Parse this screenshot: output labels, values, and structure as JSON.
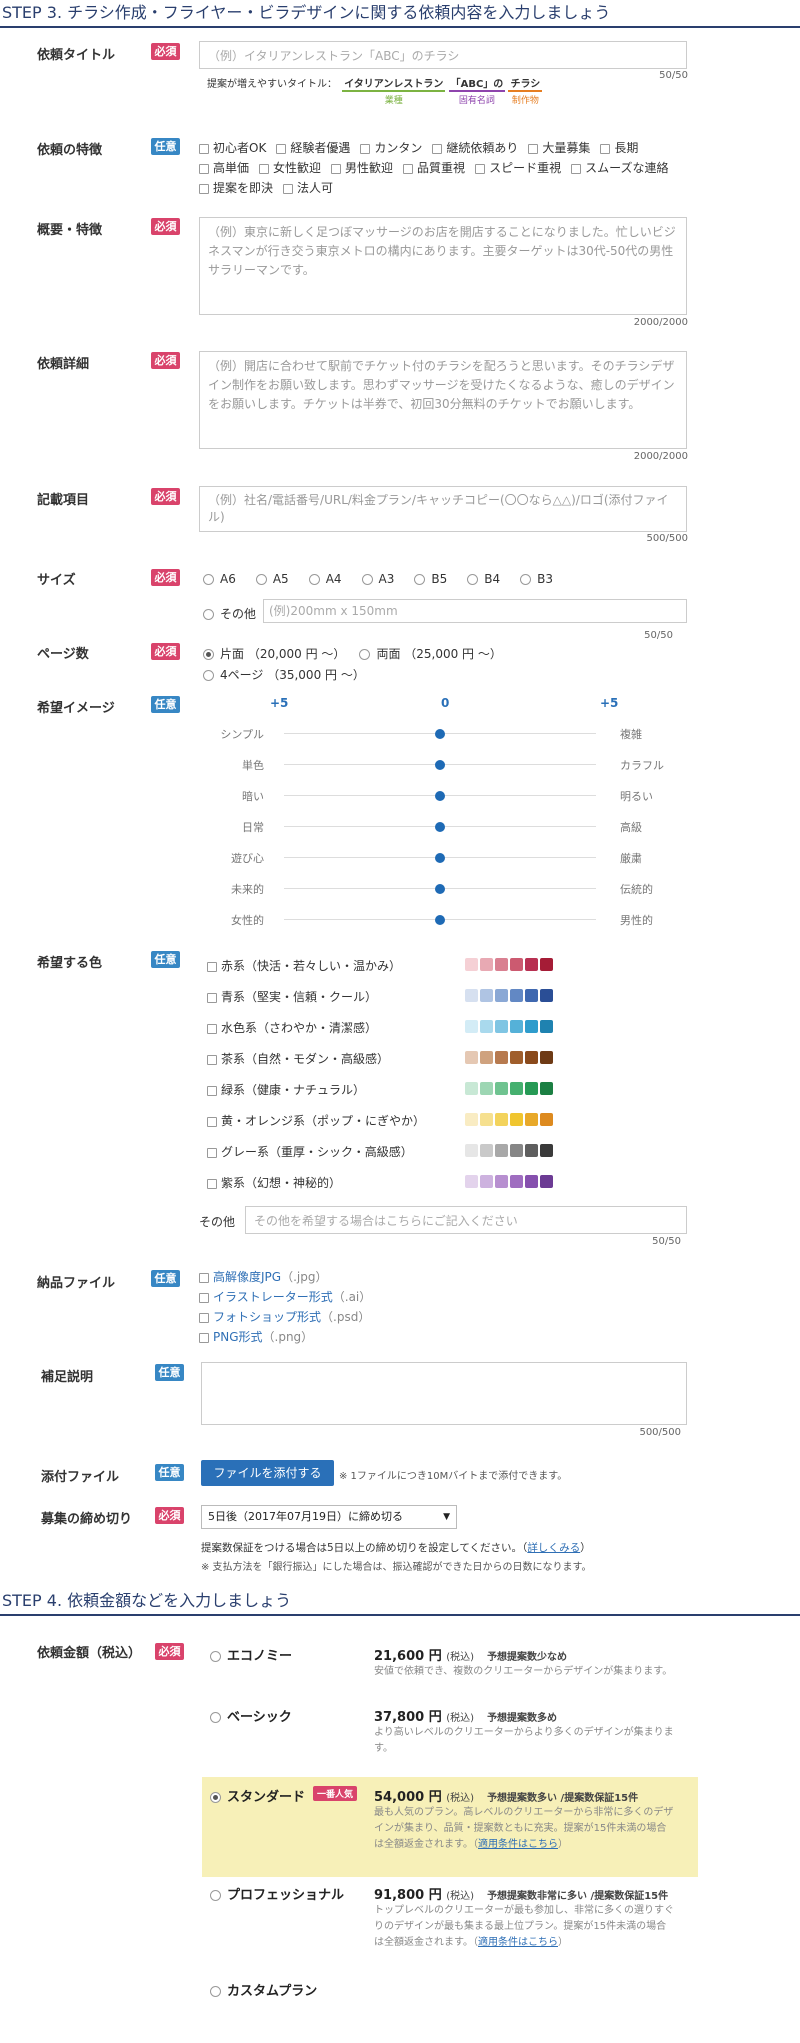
{
  "step3": {
    "title": "STEP 3. チラシ作成・フライヤー・ビラデザインに関する依頼内容を入力しましょう"
  },
  "badges": {
    "required": "必須",
    "optional": "任意"
  },
  "title_field": {
    "label": "依頼タイトル",
    "placeholder": "（例）イタリアンレストラン「ABC」のチラシ",
    "counter": "50/50",
    "hint_prefix": "提案が増えやすいタイトル：",
    "hint_parts": [
      {
        "text": "イタリアンレストラン",
        "sub": "業種",
        "color": "#7cb342"
      },
      {
        "text": "「ABC」の",
        "sub": "固有名詞",
        "color": "#8e44ad"
      },
      {
        "text": "チラシ",
        "sub": "制作物",
        "color": "#e67e22"
      }
    ]
  },
  "features": {
    "label": "依頼の特徴",
    "rows": [
      [
        "初心者OK",
        "経験者優遇",
        "カンタン",
        "継続依頼あり",
        "大量募集",
        "長期"
      ],
      [
        "高単価",
        "女性歓迎",
        "男性歓迎",
        "品質重視",
        "スピード重視",
        "スムーズな連絡"
      ],
      [
        "提案を即決",
        "法人可"
      ]
    ]
  },
  "overview": {
    "label": "概要・特徴",
    "placeholder": "（例）東京に新しく足つぼマッサージのお店を開店することになりました。忙しいビジネスマンが行き交う東京メトロの構内にあります。主要ターゲットは30代-50代の男性サラリーマンです。",
    "counter": "2000/2000"
  },
  "details": {
    "label": "依頼詳細",
    "placeholder": "（例）開店に合わせて駅前でチケット付のチラシを配ろうと思います。そのチラシデザイン制作をお願い致します。思わずマッサージを受けたくなるような、癒しのデザインをお願いします。チケットは半券で、初回30分無料のチケットでお願いします。",
    "counter": "2000/2000"
  },
  "items": {
    "label": "記載項目",
    "placeholder": "（例）社名/電話番号/URL/料金プラン/キャッチコピー(〇〇なら△△)/ロゴ(添付ファイル)",
    "counter": "500/500"
  },
  "size": {
    "label": "サイズ",
    "options": [
      "A6",
      "A5",
      "A4",
      "A3",
      "B5",
      "B4",
      "B3"
    ],
    "other_label": "その他",
    "other_placeholder": "(例)200mm x 150mm",
    "counter": "50/50"
  },
  "pages": {
    "label": "ページ数",
    "options": [
      "片面 （20,000 円 〜）",
      "両面 （25,000 円 〜）",
      "4ページ （35,000 円 〜）"
    ]
  },
  "image": {
    "label": "希望イメージ",
    "scale_left": "+5",
    "scale_mid": "0",
    "scale_right": "+5",
    "rows": [
      {
        "left": "シンプル",
        "right": "複雑",
        "value": 0
      },
      {
        "left": "単色",
        "right": "カラフル",
        "value": 0
      },
      {
        "left": "暗い",
        "right": "明るい",
        "value": 0
      },
      {
        "left": "日常",
        "right": "高級",
        "value": 0
      },
      {
        "left": "遊び心",
        "right": "厳粛",
        "value": 0
      },
      {
        "left": "未来的",
        "right": "伝統的",
        "value": 0
      },
      {
        "left": "女性的",
        "right": "男性的",
        "value": 0
      }
    ]
  },
  "colors": {
    "label": "希望する色",
    "rows": [
      {
        "name": "赤系（快活・若々しい・温かみ）",
        "swatches": [
          "#f5d0d5",
          "#e8a9b3",
          "#d98091",
          "#cc5a70",
          "#b83052",
          "#a51c36"
        ]
      },
      {
        "name": "青系（堅実・信頼・クール）",
        "swatches": [
          "#d6e0f0",
          "#afc4e3",
          "#8aa8d5",
          "#6288c4",
          "#3f68b0",
          "#2a4e96"
        ]
      },
      {
        "name": "水色系（さわやか・清潔感）",
        "swatches": [
          "#d3ecf6",
          "#a9d9ed",
          "#7fc5e3",
          "#55b1d8",
          "#2e9ccc",
          "#1f82b0"
        ]
      },
      {
        "name": "茶系（自然・モダン・高級感）",
        "swatches": [
          "#e5c8b3",
          "#cfa27e",
          "#b77a4f",
          "#a05e2b",
          "#8a4a1c",
          "#6e3a15"
        ]
      },
      {
        "name": "緑系（健康・ナチュラル）",
        "swatches": [
          "#c8e8d5",
          "#9dd6b3",
          "#6fc390",
          "#45b06f",
          "#269a55",
          "#1b7f43"
        ]
      },
      {
        "name": "黄・オレンジ系（ポップ・にぎやか）",
        "swatches": [
          "#f9ecc3",
          "#f6e08f",
          "#f3d35c",
          "#f0c52f",
          "#e8a92a",
          "#dd8a1f"
        ]
      },
      {
        "name": "グレー系（重厚・シック・高級感）",
        "swatches": [
          "#e6e6e6",
          "#c9c9c9",
          "#a8a8a8",
          "#868686",
          "#5e5e5e",
          "#3a3a3a"
        ]
      },
      {
        "name": "紫系（幻想・神秘的）",
        "swatches": [
          "#e3d3ec",
          "#cdb2df",
          "#b78fd0",
          "#9f6dc0",
          "#8650ae",
          "#6c3b94"
        ]
      }
    ],
    "other_label": "その他",
    "other_placeholder": "その他を希望する場合はこちらにご記入ください",
    "counter": "50/50"
  },
  "delivery": {
    "label": "納品ファイル",
    "options": [
      {
        "name": "高解像度JPG",
        "ext": "（.jpg）"
      },
      {
        "name": "イラストレーター形式",
        "ext": "（.ai）"
      },
      {
        "name": "フォトショップ形式",
        "ext": "（.psd）"
      },
      {
        "name": "PNG形式",
        "ext": "（.png）"
      }
    ]
  },
  "supplement": {
    "label": "補足説明",
    "counter": "500/500"
  },
  "attach": {
    "label": "添付ファイル",
    "button": "ファイルを添付する",
    "note": "※ 1ファイルにつき10Mバイトまで添付できます。"
  },
  "deadline": {
    "label": "募集の締め切り",
    "value": "5日後（2017年07月19日）に締め切る",
    "note1_a": "提案数保証をつける場合は5日以上の締め切りを設定してください。（",
    "note1_link": "詳しくみる",
    "note1_b": "）",
    "note2": "※ 支払方法を「銀行振込」にした場合は、振込確認ができた日からの日数になります。"
  },
  "step4": {
    "title": "STEP 4. 依頼金額などを入力しましょう"
  },
  "budget": {
    "label": "依頼金額（税込）",
    "tax": "(税込)",
    "plans": [
      {
        "name": "エコノミー",
        "price": "21,600 円",
        "note": "予想提案数少なめ",
        "desc1": "安値で依頼でき、複数のクリエーターからデザインが集まります。",
        "desc2": "",
        "link": "",
        "tail": ""
      },
      {
        "name": "ベーシック",
        "price": "37,800 円",
        "note": "予想提案数多め",
        "desc1": "より高いレベルのクリエーターからより多くのデザインが集まりま",
        "desc2": "す。",
        "link": "",
        "tail": ""
      },
      {
        "name": "スタンダード",
        "badge": "一番人気",
        "price": "54,000 円",
        "note": "予想提案数多い /提案数保証15件",
        "desc1": "最も人気のプラン。高レベルのクリエーターから非常に多くのデザ",
        "desc2": "インが集まり、品質・提案数ともに充実。提案が15件未満の場合",
        "desc3": "は全額返金されます。（",
        "link": "適用条件はこちら",
        "tail": "）"
      },
      {
        "name": "プロフェッショナル",
        "price": "91,800 円",
        "note": "予想提案数非常に多い /提案数保証15件",
        "desc1": "トップレベルのクリエーターが最も参加し、非常に多くの選りすぐ",
        "desc2": "りのデザインが最も集まる最上位プラン。提案が15件未満の場合",
        "desc3": "は全額返金されます。（",
        "link": "適用条件はこちら",
        "tail": "）"
      },
      {
        "name": "カスタムプラン"
      }
    ]
  }
}
